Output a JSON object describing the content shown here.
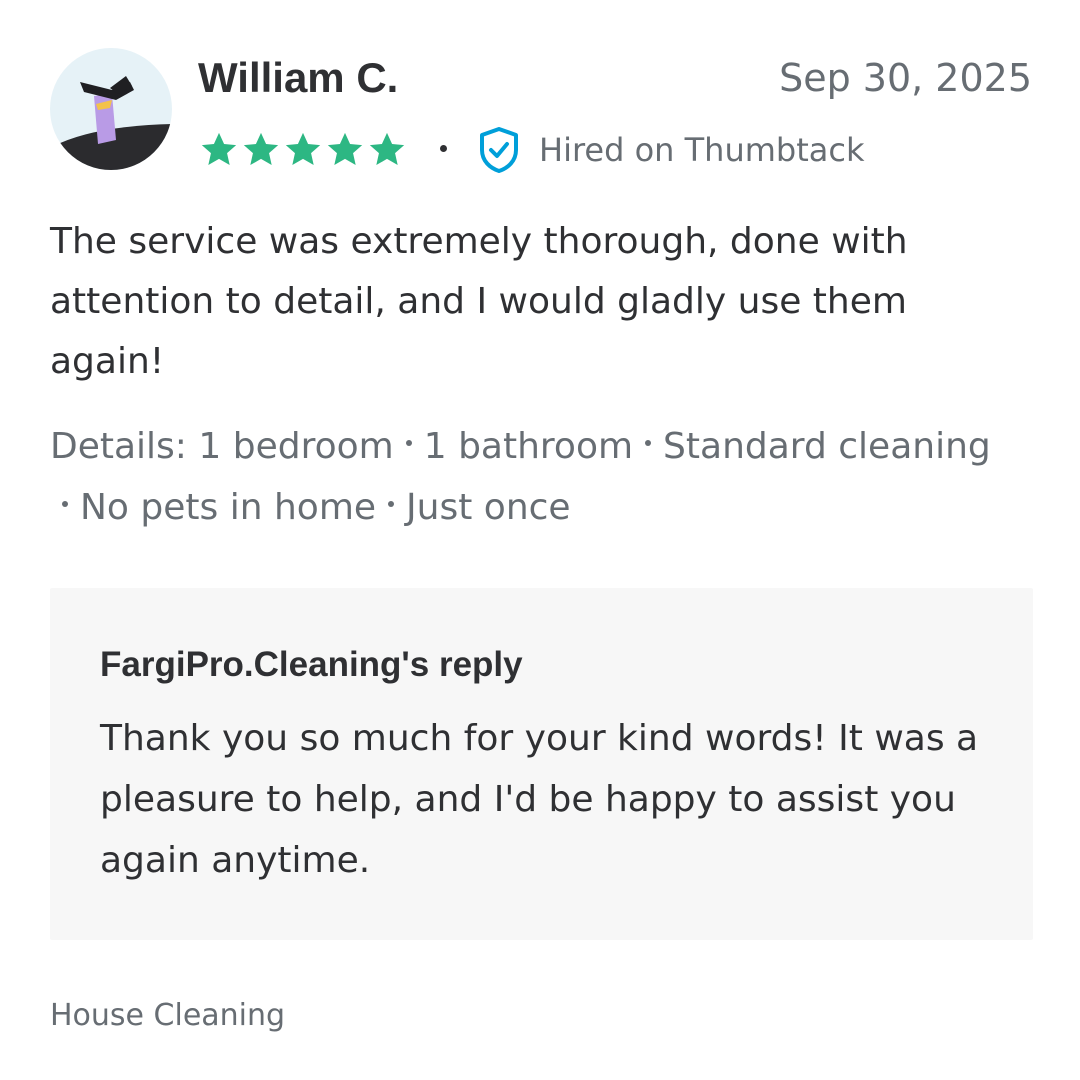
{
  "review": {
    "reviewer_name": "William C.",
    "date": "Sep 30, 2025",
    "rating": 5,
    "rating_max": 5,
    "star_color": "#2db783",
    "hired_label": "Hired on Thumbtack",
    "badge_color": "#009fd9",
    "badge_icon": "shield-check-icon",
    "text": "The service was extremely thorough, done with attention to detail, and I would gladly use them again!",
    "details": [
      "Details: 1 bedroom",
      "1 bathroom",
      "Standard cleaning",
      "No pets in home",
      "Just once"
    ]
  },
  "reply": {
    "title": "FargiPro.Cleaning's reply",
    "text": "Thank you so much for your kind words! It was a pleasure to help, and I'd be happy to assist you again anytime."
  },
  "category": "House Cleaning"
}
